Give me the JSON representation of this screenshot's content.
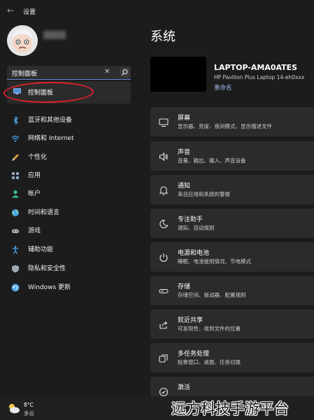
{
  "window": {
    "title": "设置",
    "back_glyph": "←"
  },
  "search": {
    "value": "控制面板",
    "clear_glyph": "✕"
  },
  "suggestion": {
    "label": "控制面板"
  },
  "sidebar": {
    "items": [
      {
        "label": "蓝牙和其他设备",
        "icon": "bluetooth-icon",
        "color": "#4aa3e8"
      },
      {
        "label": "网络和 Internet",
        "icon": "wifi-icon",
        "color": "#4aa3e8"
      },
      {
        "label": "个性化",
        "icon": "brush-icon",
        "color": "#e0a040"
      },
      {
        "label": "应用",
        "icon": "apps-icon",
        "color": "#8fa0b8"
      },
      {
        "label": "帐户",
        "icon": "account-icon",
        "color": "#3fc08a"
      },
      {
        "label": "时间和语言",
        "icon": "globe-icon",
        "color": "#4aa3e8"
      },
      {
        "label": "游戏",
        "icon": "gamepad-icon",
        "color": "#b0b0b0"
      },
      {
        "label": "辅助功能",
        "icon": "accessibility-icon",
        "color": "#4aa3e8"
      },
      {
        "label": "隐私和安全性",
        "icon": "shield-icon",
        "color": "#a0a8b8"
      },
      {
        "label": "Windows 更新",
        "icon": "update-icon",
        "color": "#4aa3e8"
      }
    ]
  },
  "main": {
    "title": "系统",
    "device": {
      "name": "LAPTOP-AMA0ATES",
      "model": "HP Pavilion Plus Laptop 14-eh0xxx",
      "rename": "重命名"
    },
    "cards": [
      {
        "title": "屏幕",
        "subtitle": "显示器、亮度、夜间模式、显示描述文件",
        "icon": "display-icon"
      },
      {
        "title": "声音",
        "subtitle": "音量、输出、输入、声音设备",
        "icon": "speaker-icon"
      },
      {
        "title": "通知",
        "subtitle": "来自应用和系统的警报",
        "icon": "bell-icon"
      },
      {
        "title": "专注助手",
        "subtitle": "通知、自动规则",
        "icon": "moon-icon"
      },
      {
        "title": "电源和电池",
        "subtitle": "睡眠、电池使用情况、节电模式",
        "icon": "power-icon"
      },
      {
        "title": "存储",
        "subtitle": "存储空间、驱动器、配置规则",
        "icon": "storage-icon"
      },
      {
        "title": "就近共享",
        "subtitle": "可发现性、收到文件的位置",
        "icon": "share-icon"
      },
      {
        "title": "多任务处理",
        "subtitle": "贴靠窗口、桌面、任务切换",
        "icon": "multitask-icon"
      },
      {
        "title": "激活",
        "subtitle": "",
        "icon": "activation-icon"
      }
    ]
  },
  "taskbar": {
    "temperature": "8°C",
    "condition": "多云",
    "weather_icon": "cloud-icon"
  },
  "watermark": "远方科技手游平台",
  "colors": {
    "accent": "#4aa3e8",
    "highlight_ring": "#e0202a",
    "link": "#9ab8ea"
  }
}
